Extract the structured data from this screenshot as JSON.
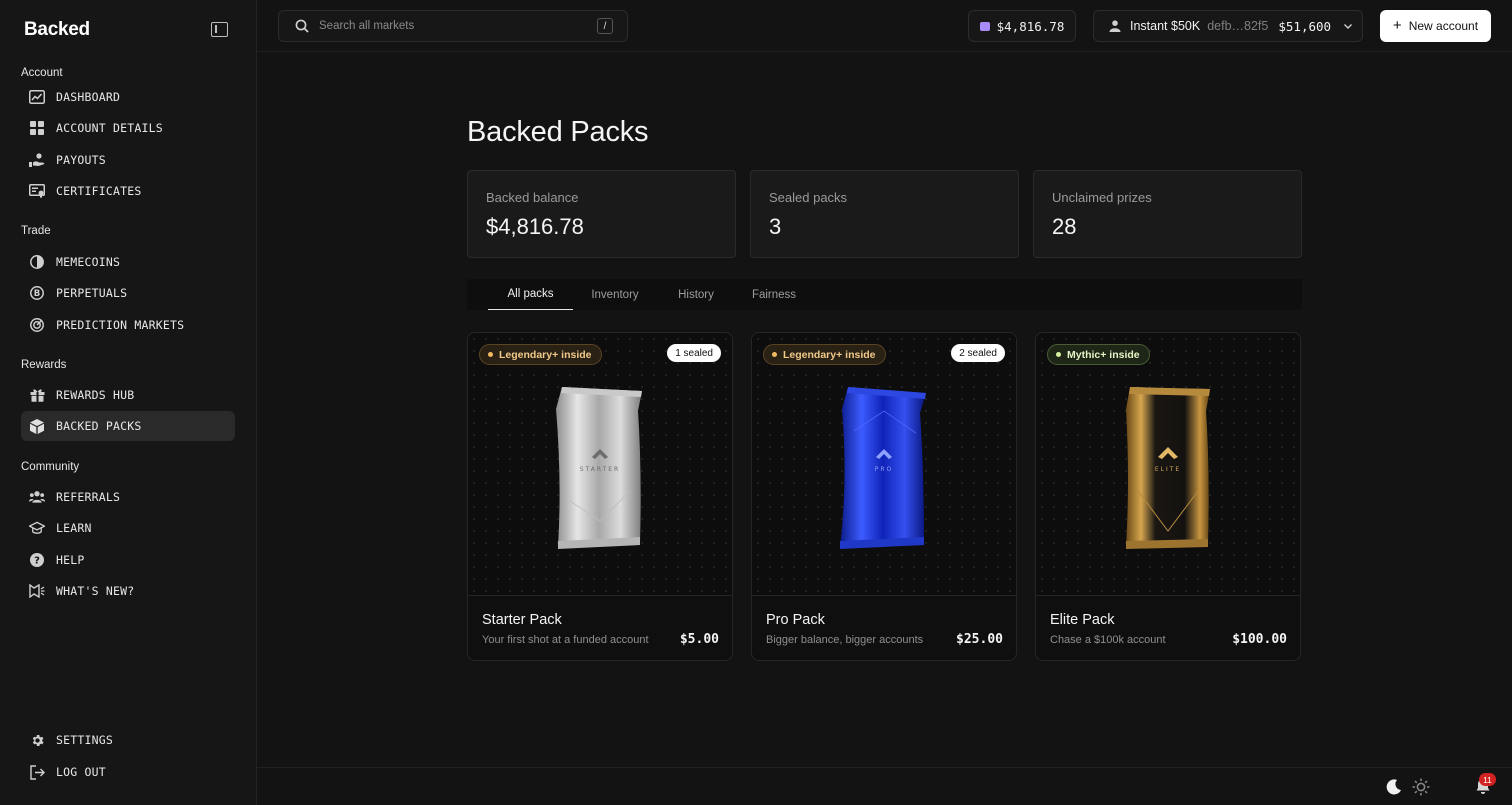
{
  "app": {
    "logo": "Backed"
  },
  "sidebar": {
    "sections": [
      {
        "title": "Account"
      },
      {
        "title": "Trade"
      },
      {
        "title": "Rewards"
      },
      {
        "title": "Community"
      }
    ],
    "items": [
      {
        "label": "DASHBOARD",
        "icon": "chart-icon"
      },
      {
        "label": "ACCOUNT DETAILS",
        "icon": "grid-icon"
      },
      {
        "label": "PAYOUTS",
        "icon": "hand-coin-icon"
      },
      {
        "label": "CERTIFICATES",
        "icon": "certificate-icon"
      },
      {
        "label": "MEMECOINS",
        "icon": "coin-icon"
      },
      {
        "label": "PERPETUALS",
        "icon": "bitcoin-icon"
      },
      {
        "label": "PREDICTION MARKETS",
        "icon": "gauge-icon"
      },
      {
        "label": "REWARDS HUB",
        "icon": "gift-icon"
      },
      {
        "label": "BACKED PACKS",
        "icon": "box-icon",
        "active": true
      },
      {
        "label": "REFERRALS",
        "icon": "users-icon"
      },
      {
        "label": "LEARN",
        "icon": "graduation-cap-icon"
      },
      {
        "label": "HELP",
        "icon": "help-icon"
      },
      {
        "label": "WHAT'S NEW?",
        "icon": "megaphone-icon"
      },
      {
        "label": "SETTINGS",
        "icon": "gear-icon"
      },
      {
        "label": "LOG OUT",
        "icon": "logout-icon"
      }
    ]
  },
  "header": {
    "search": {
      "placeholder": "Search all markets",
      "shortcut": "/"
    },
    "balance": "$4,816.78",
    "account": {
      "name": "Instant $50K",
      "id": "defb…82f5",
      "value": "$51,600"
    },
    "new_account_label": "New account"
  },
  "main": {
    "title": "Backed Packs",
    "stats": [
      {
        "label": "Backed balance",
        "value": "$4,816.78"
      },
      {
        "label": "Sealed packs",
        "value": "3"
      },
      {
        "label": "Unclaimed prizes",
        "value": "28"
      }
    ],
    "tabs": [
      "All packs",
      "Inventory",
      "History",
      "Fairness"
    ],
    "active_tab": "All packs",
    "packs": [
      {
        "name": "Starter Pack",
        "desc": "Your first shot at a funded account",
        "price": "$5.00",
        "badge": "Legendary+ inside",
        "sealed": "1 sealed",
        "pack_word": "STARTER",
        "color": "silver"
      },
      {
        "name": "Pro Pack",
        "desc": "Bigger balance, bigger accounts",
        "price": "$25.00",
        "badge": "Legendary+ inside",
        "sealed": "2 sealed",
        "pack_word": "PRO",
        "color": "blue"
      },
      {
        "name": "Elite Pack",
        "desc": "Chase a $100k account",
        "price": "$100.00",
        "badge": "Mythic+ inside",
        "sealed": "",
        "pack_word": "ELITE",
        "color": "gold"
      }
    ]
  },
  "footer": {
    "notification_count": "11"
  },
  "colors": {
    "accent": "#a78bfa",
    "legendary": "#f1b960",
    "mythic": "#d6f09e",
    "notification": "#d32222"
  }
}
